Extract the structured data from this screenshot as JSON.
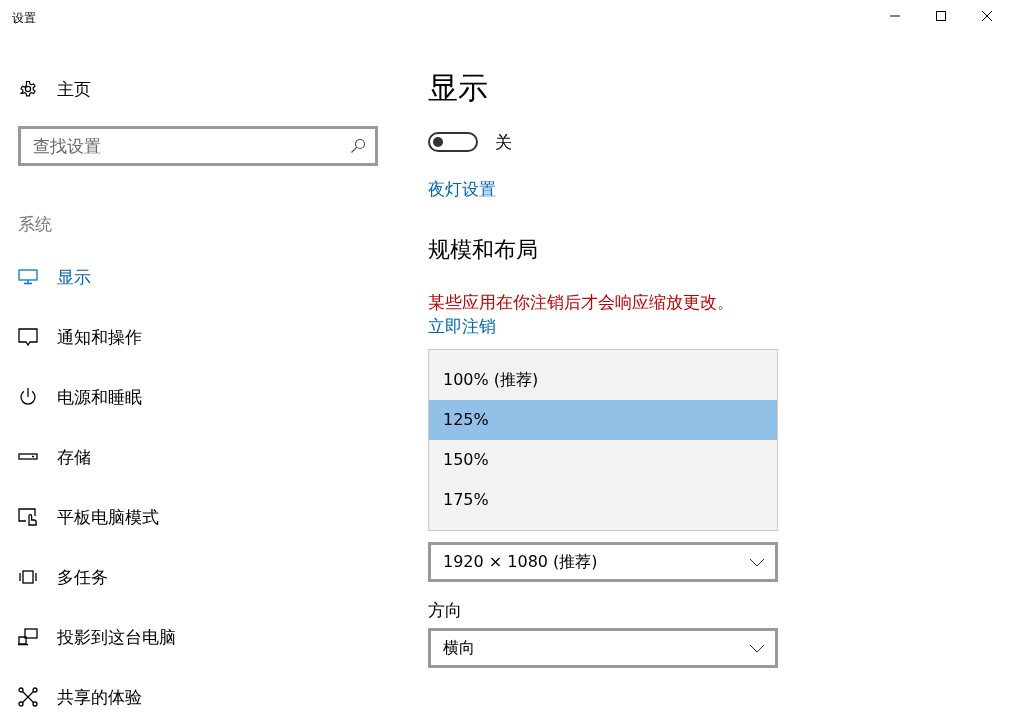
{
  "window": {
    "title": "设置"
  },
  "sidebar": {
    "home": "主页",
    "search": {
      "placeholder": "查找设置"
    },
    "section": "系统",
    "items": [
      {
        "label": "显示",
        "selected": true
      },
      {
        "label": "通知和操作",
        "selected": false
      },
      {
        "label": "电源和睡眠",
        "selected": false
      },
      {
        "label": "存储",
        "selected": false
      },
      {
        "label": "平板电脑模式",
        "selected": false
      },
      {
        "label": "多任务",
        "selected": false
      },
      {
        "label": "投影到这台电脑",
        "selected": false
      },
      {
        "label": "共享的体验",
        "selected": false
      }
    ]
  },
  "content": {
    "title": "显示",
    "night_light": {
      "on": false,
      "state_label": "关"
    },
    "night_light_link": "夜灯设置",
    "scale_heading": "规模和布局",
    "warning": "某些应用在你注销后才会响应缩放更改。",
    "sign_out_link": "立即注销",
    "scale_options": [
      {
        "label": "100% (推荐)",
        "selected": false
      },
      {
        "label": "125%",
        "selected": true
      },
      {
        "label": "150%",
        "selected": false
      },
      {
        "label": "175%",
        "selected": false
      }
    ],
    "resolution": {
      "value": "1920 × 1080 (推荐)"
    },
    "orientation_label": "方向",
    "orientation": {
      "value": "横向"
    }
  }
}
